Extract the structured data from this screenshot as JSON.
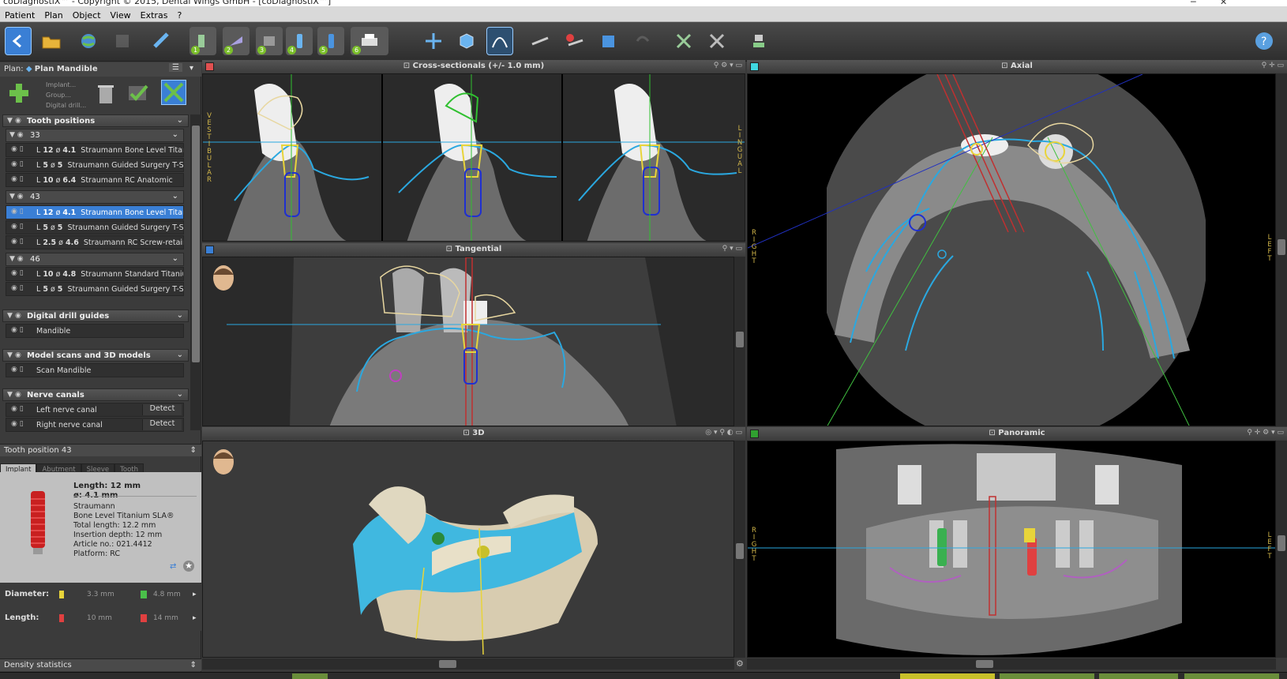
{
  "window": {
    "title": "coDiagnostiX™ - Copyright © 2015, Dental Wings GmbH - [coDiagnostiX™]"
  },
  "menu": [
    "Patient",
    "Plan",
    "Object",
    "View",
    "Extras",
    "?"
  ],
  "plan": {
    "label": "Plan:",
    "name": "Plan Mandible"
  },
  "add_menu": {
    "items": [
      "Implant...",
      "Group...",
      "Digital drill..."
    ]
  },
  "sections": {
    "tooth_positions": "Tooth positions",
    "digital_drill_guides": "Digital drill guides",
    "model_scans": "Model scans and 3D models",
    "nerve_canals": "Nerve canals"
  },
  "tooth_groups": [
    {
      "id": "33",
      "rows": [
        {
          "L": "12",
          "d": "4.1",
          "name": "Straumann Bone Level Titani..."
        },
        {
          "L": "5",
          "d": "5",
          "name": "Straumann Guided Surgery T-Sl..."
        },
        {
          "L": "10",
          "d": "6.4",
          "name": "Straumann RC Anatomic"
        }
      ]
    },
    {
      "id": "43",
      "rows": [
        {
          "L": "12",
          "d": "4.1",
          "name": "Straumann Bone Level Titani..."
        },
        {
          "L": "5",
          "d": "5",
          "name": "Straumann Guided Surgery T-Sl..."
        },
        {
          "L": "2.5",
          "d": "4.6",
          "name": "Straumann RC Screw-retaine..."
        }
      ]
    },
    {
      "id": "46",
      "rows": [
        {
          "L": "10",
          "d": "4.8",
          "name": "Straumann Standard Titaniu..."
        },
        {
          "L": "5",
          "d": "5",
          "name": "Straumann Guided Surgery T-Sl..."
        }
      ]
    }
  ],
  "drill_guides": [
    "Mandible"
  ],
  "model_scans": [
    "Scan Mandible"
  ],
  "nerve_canals": [
    {
      "name": "Left nerve canal",
      "action": "Detect"
    },
    {
      "name": "Right nerve canal",
      "action": "Detect"
    }
  ],
  "detail": {
    "title": "Tooth position 43",
    "tabs": [
      "Implant",
      "Abutment",
      "Sleeve",
      "Tooth"
    ],
    "length": "Length: 12 mm",
    "diameter": "ø: 4.1 mm",
    "lines": [
      "Straumann",
      "Bone Level Titanium SLA®",
      "Total length: 12.2 mm",
      "Insertion depth: 12 mm",
      "Article no.: 021.4412",
      "Platform: RC"
    ],
    "diameter_label": "Diameter:",
    "diameter_min": "3.3 mm",
    "diameter_max": "4.8 mm",
    "length_label": "Length:",
    "length_min": "10 mm",
    "length_max": "14 mm"
  },
  "density": "Density statistics",
  "views": {
    "cross": "Cross-sectionals (+/- 1.0 mm)",
    "axial": "Axial",
    "tangential": "Tangential",
    "three_d": "3D",
    "panoramic": "Panoramic"
  },
  "orientation": {
    "vestibular": "VESTIBULAR",
    "lingual": "LINGUAL",
    "right": "RIGHT",
    "left": "LEFT"
  },
  "toolbar_icons": [
    "back-icon",
    "open-folder-icon",
    "globe-icon",
    "disabled-icon",
    "tool-icon",
    "implant-step-1-icon",
    "implant-step-2-icon",
    "implant-step-3-icon",
    "implant-step-4-icon",
    "implant-step-5-icon",
    "print-step-6-icon",
    "axis-icon",
    "cube-icon",
    "curve-icon",
    "probe-icon",
    "delete-probe-icon",
    "box-icon",
    "undo-icon",
    "cut-icon",
    "cut-2-icon",
    "robot-icon",
    "help-icon"
  ],
  "colors": {
    "accent": "#3a7fd5",
    "cross_swatch": "#e05050",
    "axial_swatch": "#40d8e0",
    "tangent_swatch": "#3a7fd5",
    "pano_swatch": "#30a030",
    "orient_text": "#d4b84a"
  }
}
